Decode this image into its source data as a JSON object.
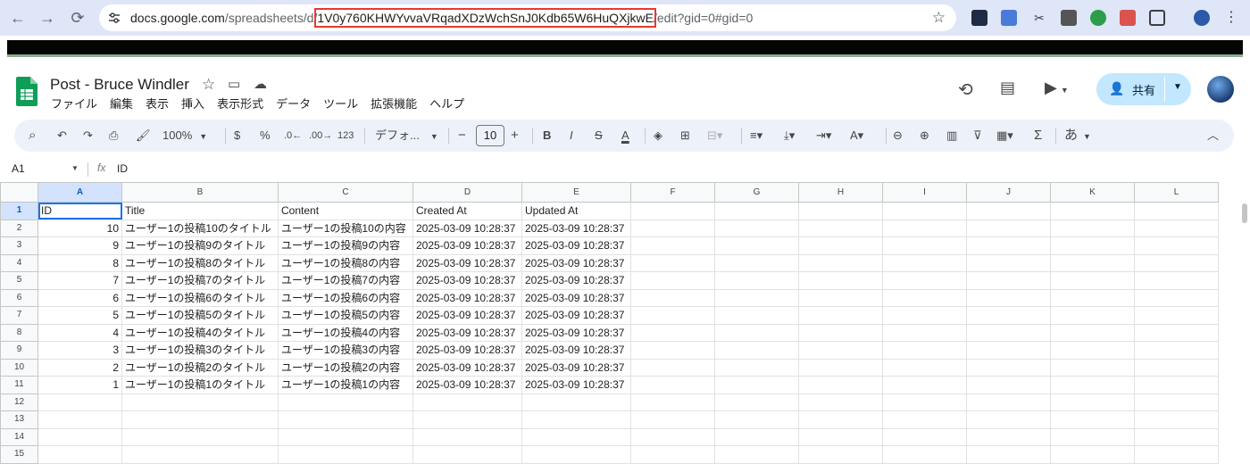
{
  "browser": {
    "url_prefix": "docs.google.com",
    "url_path1": "/spreadsheets/d/",
    "url_id": "1V0y760KHWYvvaVRqadXDzWchSnJ0Kdb65W6HuQXjkwE",
    "url_suffix": "/edit?gid=0#gid=0",
    "icons": [
      "back-arrow-icon",
      "forward-arrow-icon",
      "reload-icon",
      "site-settings-icon",
      "bookmark-star-icon",
      "extensions-icon",
      "profile-icon",
      "menu-kebab-icon"
    ]
  },
  "doc": {
    "title": "Post - Bruce Windler",
    "menu": [
      "ファイル",
      "編集",
      "表示",
      "挿入",
      "表示形式",
      "データ",
      "ツール",
      "拡張機能",
      "ヘルプ"
    ],
    "share_label": "共有"
  },
  "toolbar": {
    "zoom": "100%",
    "currency": "$",
    "percent": "%",
    "dec_minus": ".0←",
    "dec_plus": ".00→",
    "format_number": "123",
    "font": "デフォ...",
    "minus": "−",
    "font_size": "10",
    "plus": "+",
    "bold": "B",
    "italic": "I",
    "strike": "S",
    "text_color": "A",
    "sum": "Σ",
    "input_tool": "あ"
  },
  "formula": {
    "namebox": "A1",
    "fx": "fx",
    "value": "ID"
  },
  "sheet": {
    "columns": [
      "A",
      "B",
      "C",
      "D",
      "E",
      "F",
      "G",
      "H",
      "I",
      "J",
      "K",
      "L"
    ],
    "row_numbers": [
      "1",
      "2",
      "3",
      "4",
      "5",
      "6",
      "7",
      "8",
      "9",
      "10",
      "11",
      "12",
      "13",
      "14",
      "15"
    ],
    "header": [
      "ID",
      "Title",
      "Content",
      "Created At",
      "Updated At"
    ],
    "rows": [
      [
        "10",
        "ユーザー1の投稿10のタイトル",
        "ユーザー1の投稿10の内容",
        "2025-03-09 10:28:37",
        "2025-03-09 10:28:37"
      ],
      [
        "9",
        "ユーザー1の投稿9のタイトル",
        "ユーザー1の投稿9の内容",
        "2025-03-09 10:28:37",
        "2025-03-09 10:28:37"
      ],
      [
        "8",
        "ユーザー1の投稿8のタイトル",
        "ユーザー1の投稿8の内容",
        "2025-03-09 10:28:37",
        "2025-03-09 10:28:37"
      ],
      [
        "7",
        "ユーザー1の投稿7のタイトル",
        "ユーザー1の投稿7の内容",
        "2025-03-09 10:28:37",
        "2025-03-09 10:28:37"
      ],
      [
        "6",
        "ユーザー1の投稿6のタイトル",
        "ユーザー1の投稿6の内容",
        "2025-03-09 10:28:37",
        "2025-03-09 10:28:37"
      ],
      [
        "5",
        "ユーザー1の投稿5のタイトル",
        "ユーザー1の投稿5の内容",
        "2025-03-09 10:28:37",
        "2025-03-09 10:28:37"
      ],
      [
        "4",
        "ユーザー1の投稿4のタイトル",
        "ユーザー1の投稿4の内容",
        "2025-03-09 10:28:37",
        "2025-03-09 10:28:37"
      ],
      [
        "3",
        "ユーザー1の投稿3のタイトル",
        "ユーザー1の投稿3の内容",
        "2025-03-09 10:28:37",
        "2025-03-09 10:28:37"
      ],
      [
        "2",
        "ユーザー1の投稿2のタイトル",
        "ユーザー1の投稿2の内容",
        "2025-03-09 10:28:37",
        "2025-03-09 10:28:37"
      ],
      [
        "1",
        "ユーザー1の投稿1のタイトル",
        "ユーザー1の投稿1の内容",
        "2025-03-09 10:28:37",
        "2025-03-09 10:28:37"
      ]
    ]
  },
  "colors": {
    "accent": "#1a73e8",
    "sheets_green": "#0f9d58",
    "share_bg": "#c2e7ff",
    "url_highlight": "#e53935"
  }
}
